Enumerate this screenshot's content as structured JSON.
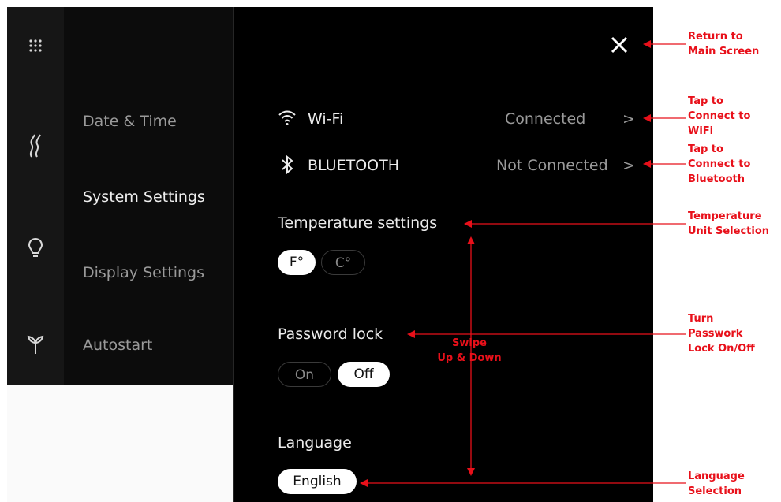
{
  "rail": {
    "icons": [
      "apps-grid-icon",
      "steam-icon",
      "light-bulb-icon",
      "plant-icon"
    ]
  },
  "menu": {
    "items": [
      {
        "label": "Date & Time",
        "active": false
      },
      {
        "label": "System Settings",
        "active": true
      },
      {
        "label": "Display Settings",
        "active": false
      },
      {
        "label": "Autostart",
        "active": false
      }
    ]
  },
  "panel": {
    "close_icon": "close-icon",
    "wifi": {
      "label": "Wi-Fi",
      "status": "Connected",
      "chevron": ">"
    },
    "bluetooth": {
      "label": "BLUETOOTH",
      "status": "Not Connected",
      "chevron": ">"
    },
    "temperature": {
      "title": "Temperature settings",
      "options": [
        "F°",
        "C°"
      ],
      "selected": "F°"
    },
    "password_lock": {
      "title": "Password lock",
      "options": [
        "On",
        "Off"
      ],
      "selected": "Off"
    },
    "language": {
      "title": "Language",
      "value": "English"
    }
  },
  "annotations": {
    "close": [
      "Return to",
      "Main Screen"
    ],
    "wifi": [
      "Tap to",
      "Connect to",
      "WiFi"
    ],
    "bluetooth": [
      "Tap to",
      "Connect to",
      "Bluetooth"
    ],
    "temperature": [
      "Temperature",
      "Unit Selection"
    ],
    "password": [
      "Turn",
      "Passwork",
      "Lock On/Off"
    ],
    "swipe": [
      "Swipe",
      "Up & Down"
    ],
    "language": [
      "Language",
      "Selection"
    ]
  },
  "colors": {
    "annotation": "#e8101a",
    "panel_bg": "#000000",
    "menu_bg": "#0c0c0c",
    "rail_bg": "#161616"
  }
}
